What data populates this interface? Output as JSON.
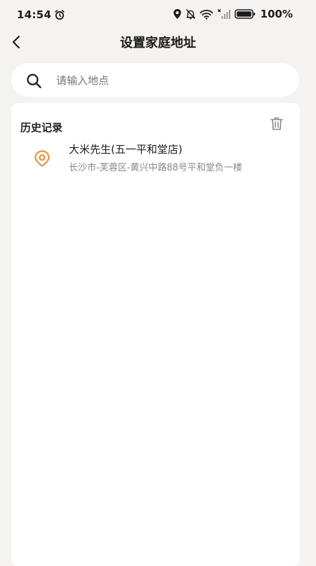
{
  "status_bar": {
    "time": "14:54",
    "battery": "100%",
    "icons": [
      "alarm-icon",
      "location-icon",
      "mute-icon",
      "wifi-icon",
      "no-signal-icon",
      "battery-icon"
    ]
  },
  "nav": {
    "back_icon": "chevron-left-icon",
    "title": "设置家庭地址"
  },
  "search": {
    "placeholder": "请输入地点",
    "value": ""
  },
  "history": {
    "title": "历史记录",
    "items": [
      {
        "name": "大米先生(五一平和堂店)",
        "address": "长沙市-芙蓉区-黄兴中路88号平和堂负一楼"
      }
    ]
  },
  "colors": {
    "background": "#f5f3f1",
    "card": "#ffffff",
    "accent": "#e0963f",
    "secondary_text": "#888888"
  }
}
